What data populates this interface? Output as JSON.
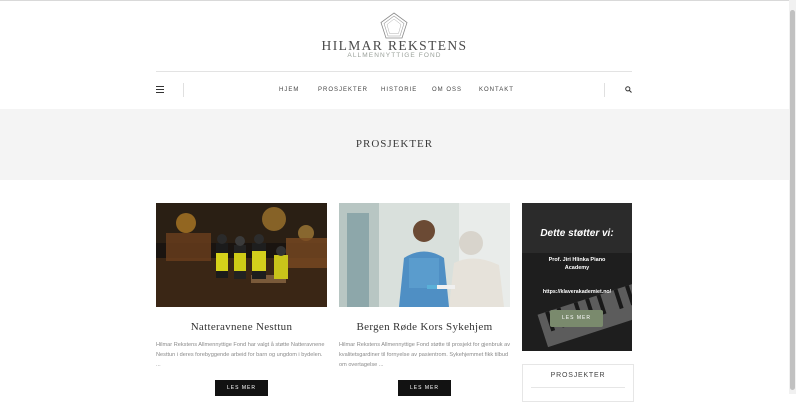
{
  "brand": {
    "title": "HILMAR REKSTENS",
    "subtitle": "ALLMENNYTTIGE FOND"
  },
  "nav": {
    "items": [
      {
        "label": "HJEM"
      },
      {
        "label": "PROSJEKTER"
      },
      {
        "label": "HISTORIE"
      },
      {
        "label": "OM OSS"
      },
      {
        "label": "KONTAKT"
      }
    ]
  },
  "page": {
    "title": "PROSJEKTER"
  },
  "cards": [
    {
      "title": "Natteravnene Nesttun",
      "excerpt": "Hilmar Rekstens Allmennyttige Fond har valgt å støtte Natteravnene Nesttun i deres forebyggende arbeid for barn og ungdom i bydelen. ...",
      "button": "LES MER"
    },
    {
      "title": "Bergen Røde Kors Sykehjem",
      "excerpt": "Hilmar Rekstens Allmennyttige Fond støtte til prosjekt for gjenbruk av kvalitetsgardiner til fornyelse av pasientrom. Sykehjemmet fikk tilbud om overtagelse ...",
      "button": "LES MER"
    }
  ],
  "sidebar": {
    "ad": {
      "heading": "Dette støtter vi:",
      "org": "Prof. Jiri Hlinka Piano Academy",
      "link": "https://klaverakademiet.no/",
      "button": "LES MER"
    },
    "widget_title": "PROSJEKTER"
  },
  "icons": {
    "menu": "hamburger-menu-icon",
    "search": "search-icon",
    "logo": "pentagon-logo-icon"
  }
}
